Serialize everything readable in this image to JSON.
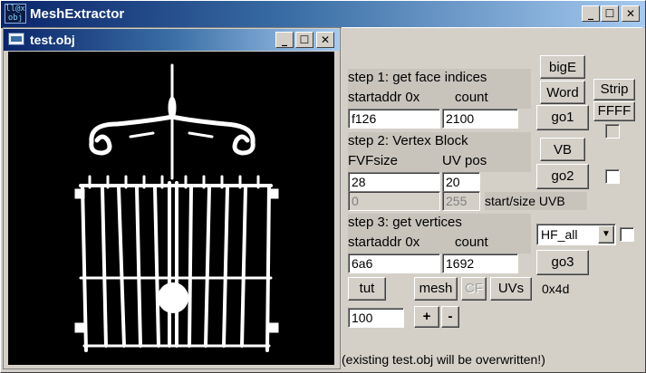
{
  "window": {
    "title": "MeshExtractor",
    "icon_text": "ll@x\nobj"
  },
  "child_window": {
    "title": "test.obj"
  },
  "step1": {
    "heading": "step 1: get face indices",
    "startaddr_label": "startaddr 0x",
    "count_label": "count",
    "startaddr_value": "f126",
    "count_value": "2100",
    "go_label": "go1"
  },
  "step2": {
    "heading": "step 2: Vertex Block",
    "fvf_label": "FVFsize",
    "uvpos_label": "UV pos",
    "fvf_value": "28",
    "uvpos_value": "20",
    "uvb_start_value": "0",
    "uvb_size_value": "255",
    "uvb_label": "start/size UVB",
    "vb_label": "VB",
    "go_label": "go2"
  },
  "step3": {
    "heading": "step 3: get vertices",
    "startaddr_label": "startaddr 0x",
    "count_label": "count",
    "startaddr_value": "6a6",
    "count_value": "1692",
    "go_label": "go3",
    "select_value": "HF_all"
  },
  "buttons": {
    "bigE": "bigE",
    "word": "Word",
    "strip": "Strip",
    "ffff": "FFFF",
    "tut": "tut",
    "mesh": "mesh",
    "cf": "CF",
    "uvs": "UVs",
    "plus": "+",
    "minus": "-"
  },
  "hex_readout": "0x4d",
  "scale_value": "100",
  "status": "(existing test.obj will be overwritten!)",
  "colors": {
    "titlebar_start": "#0a246a",
    "titlebar_end": "#a6caf0",
    "face": "#d4d0c8",
    "viewport": "#000000"
  }
}
